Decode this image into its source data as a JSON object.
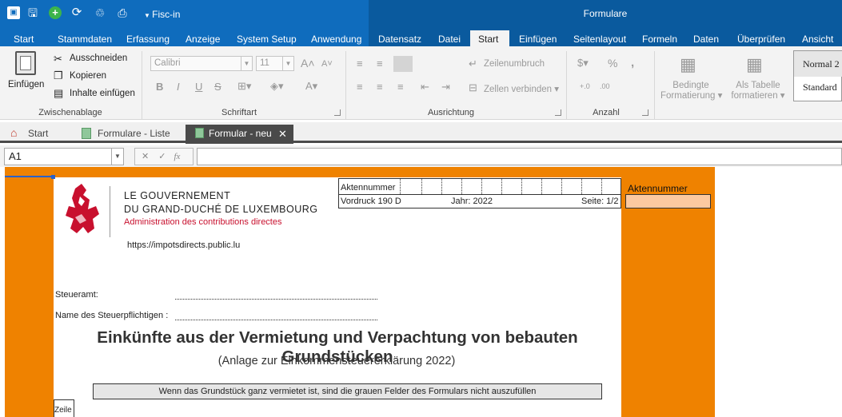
{
  "quick_access": {
    "app_menu_label": "Fisc-in"
  },
  "window": {
    "title": "Formulare"
  },
  "main_tabs": [
    {
      "label": "Start"
    },
    {
      "label": "Stammdaten"
    },
    {
      "label": "Erfassung"
    },
    {
      "label": "Anzeige"
    },
    {
      "label": "System Setup"
    },
    {
      "label": "Anwendung"
    },
    {
      "label": "Datensatz"
    },
    {
      "label": "Datei"
    },
    {
      "label": "Start"
    },
    {
      "label": "Einfügen"
    },
    {
      "label": "Seitenlayout"
    },
    {
      "label": "Formeln"
    },
    {
      "label": "Daten"
    },
    {
      "label": "Überprüfen"
    },
    {
      "label": "Ansicht"
    }
  ],
  "ribbon": {
    "clipboard": {
      "paste": "Einfügen",
      "cut": "Ausschneiden",
      "copy": "Kopieren",
      "paste_content": "Inhalte einfügen",
      "group": "Zwischenablage"
    },
    "font": {
      "font_name": "Calibri",
      "font_size": "11",
      "group": "Schriftart"
    },
    "alignment": {
      "wrap": "Zeilenumbruch",
      "merge": "Zellen verbinden",
      "group": "Ausrichtung"
    },
    "number": {
      "percent": "%",
      "comma": ",",
      "group": "Anzahl"
    },
    "styles": {
      "conditional_1": "Bedingte",
      "conditional_2": "Formatierung",
      "as_table_1": "Als Tabelle",
      "as_table_2": "formatieren",
      "style_normal": "Normal 2",
      "style_standard": "Standard"
    }
  },
  "doc_tabs": [
    {
      "label": "Start"
    },
    {
      "label": "Formulare - Liste"
    },
    {
      "label": "Formular - neu"
    }
  ],
  "formula_bar": {
    "cell_ref": "A1",
    "formula": ""
  },
  "form": {
    "gov_line1": "LE GOUVERNEMENT",
    "gov_line2": "DU GRAND-DUCHÉ DE LUXEMBOURG",
    "gov_line3": "Administration des contributions directes",
    "url": "https://impotsdirects.public.lu",
    "akt_label": "Aktennummer",
    "vordruck": "Vordruck 190 D",
    "jahr": "Jahr: 2022",
    "seite": "Seite: 1/2",
    "akt_side_label": "Aktennummer",
    "steueramt_label": "Steueramt:",
    "name_label": "Name des Steuerpflichtigen :",
    "title": "Einkünfte aus der Vermietung und Verpachtung von bebauten Grundstücken",
    "subtitle": "(Anlage zur Einkommensteuererklärung 2022)",
    "notice": "Wenn das Grundstück ganz vermietet ist, sind die grauen Felder des Formulars nicht auszufüllen",
    "zeile": "Zeile"
  },
  "colors": {
    "titlebar": "#0f6cbd",
    "sheet_background": "#ef8200",
    "aktennummer_input": "#fcc9a0",
    "logo_red": "#c8102e"
  }
}
